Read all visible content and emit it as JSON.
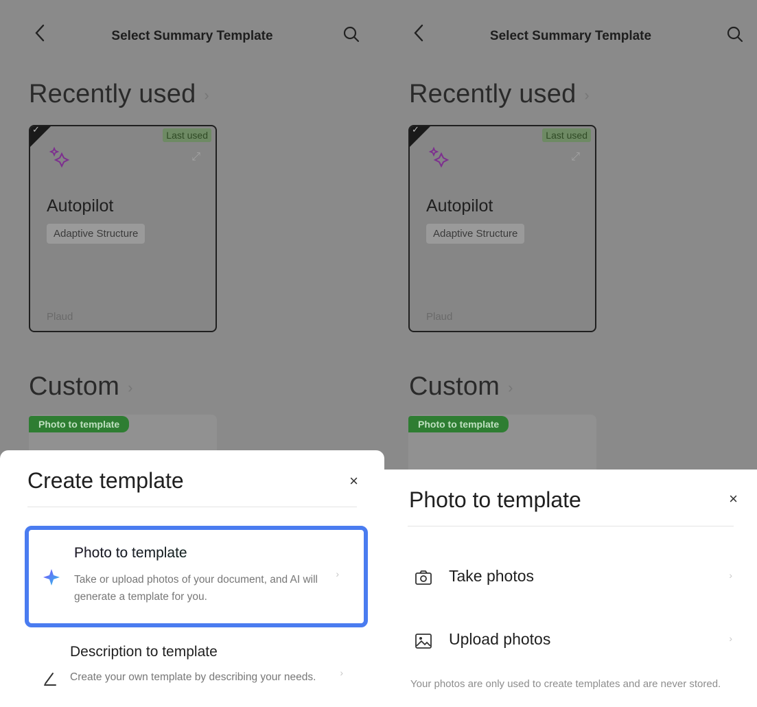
{
  "header": {
    "title": "Select Summary Template"
  },
  "sections": {
    "recent": "Recently used",
    "custom": "Custom"
  },
  "template_card": {
    "badge": "Last used",
    "name": "Autopilot",
    "tag": "Adaptive Structure",
    "brand": "Plaud"
  },
  "custom_card": {
    "pill": "Photo to template"
  },
  "create_sheet": {
    "title": "Create template",
    "close": "×",
    "options": [
      {
        "title": "Photo to template",
        "desc": "Take or upload photos of your document, and AI will generate a template for you."
      },
      {
        "title": "Description to template",
        "desc": "Create your own template by describing your needs."
      }
    ]
  },
  "photo_sheet": {
    "title": "Photo to template",
    "close": "×",
    "options": [
      {
        "label": "Take photos"
      },
      {
        "label": "Upload photos"
      }
    ],
    "note": "Your photos are only used to create templates and are never stored."
  },
  "colors": {
    "highlight": "#4a7cf0",
    "pill_bg": "#2e7d32",
    "overlay": "#8a8a8a"
  }
}
